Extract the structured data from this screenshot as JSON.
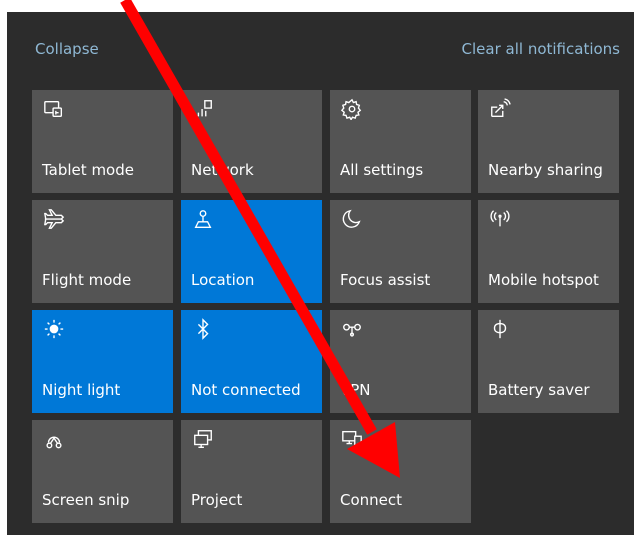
{
  "header": {
    "collapse_label": "Collapse",
    "clear_label": "Clear all notifications"
  },
  "tiles": [
    {
      "label": "Tablet mode",
      "icon": "tablet-mode-icon",
      "active": false
    },
    {
      "label": "Network",
      "icon": "network-icon",
      "active": false
    },
    {
      "label": "All settings",
      "icon": "gear-icon",
      "active": false
    },
    {
      "label": "Nearby sharing",
      "icon": "nearby-sharing-icon",
      "active": false
    },
    {
      "label": "Flight mode",
      "icon": "airplane-icon",
      "active": false
    },
    {
      "label": "Location",
      "icon": "location-icon",
      "active": true
    },
    {
      "label": "Focus assist",
      "icon": "moon-icon",
      "active": false
    },
    {
      "label": "Mobile hotspot",
      "icon": "hotspot-icon",
      "active": false
    },
    {
      "label": "Night light",
      "icon": "sun-icon",
      "active": true
    },
    {
      "label": "Not connected",
      "icon": "bluetooth-icon",
      "active": true
    },
    {
      "label": "VPN",
      "icon": "vpn-icon",
      "active": false
    },
    {
      "label": "Battery saver",
      "icon": "battery-saver-icon",
      "active": false
    },
    {
      "label": "Screen snip",
      "icon": "screen-snip-icon",
      "active": false
    },
    {
      "label": "Project",
      "icon": "project-icon",
      "active": false
    },
    {
      "label": "Connect",
      "icon": "connect-icon",
      "active": false
    }
  ],
  "colors": {
    "panel_bg": "#2c2c2c",
    "tile_bg": "#545454",
    "tile_active_bg": "#0078d7",
    "header_link": "#8fb8d4",
    "annotation_arrow": "#ff0000"
  }
}
